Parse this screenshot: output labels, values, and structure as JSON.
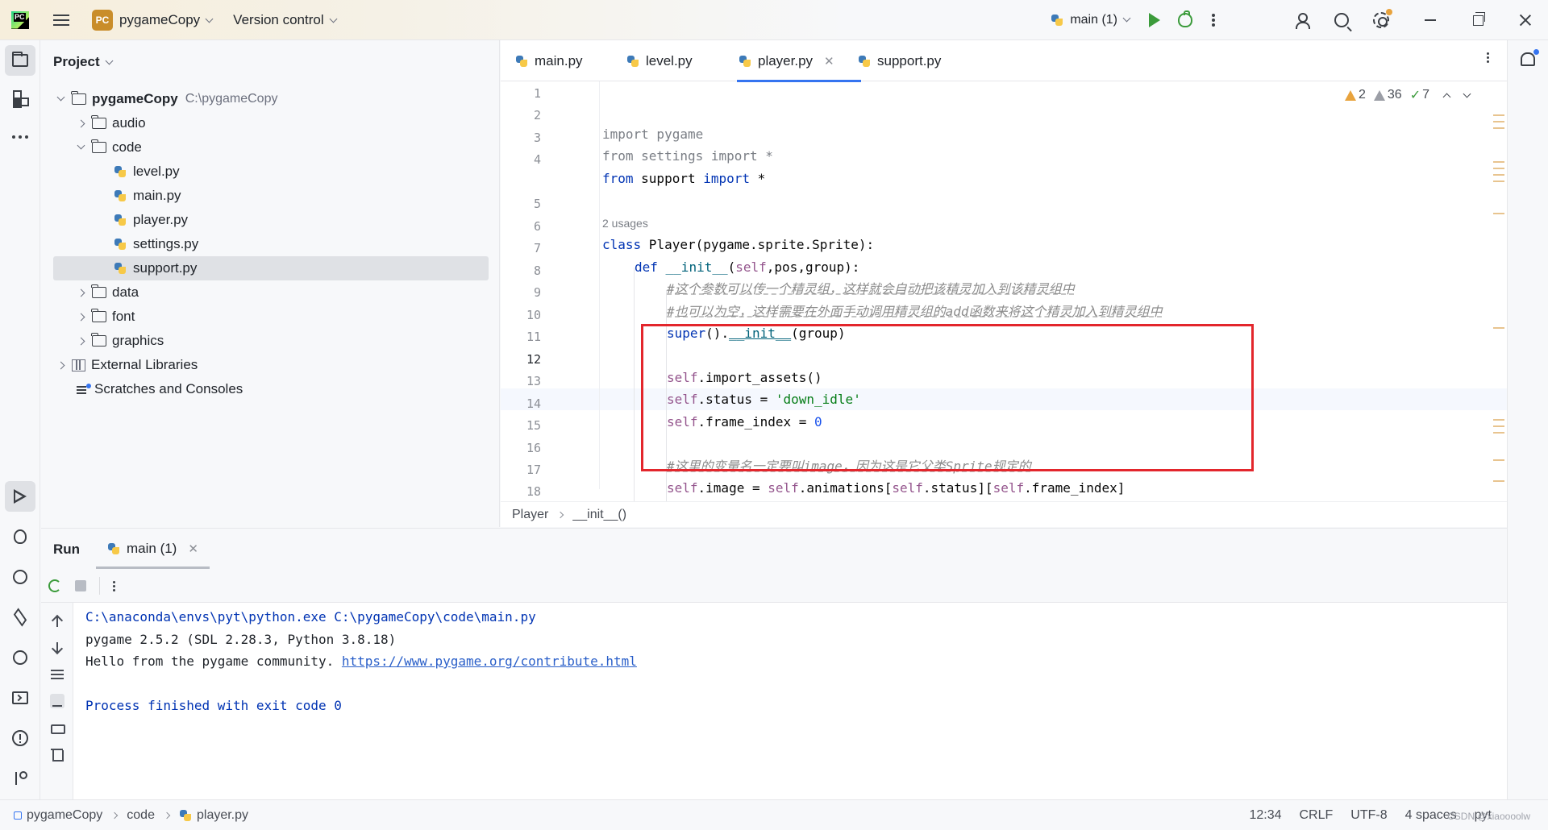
{
  "titlebar": {
    "app_logo_text": "PC",
    "project_badge": "PC",
    "project_name": "pygameCopy",
    "vcs_label": "Version control",
    "run_config": "main (1)"
  },
  "project_panel": {
    "title": "Project",
    "root_name": "pygameCopy",
    "root_path": "C:\\pygameCopy",
    "items": [
      {
        "label": "audio"
      },
      {
        "label": "code"
      },
      {
        "label": "level.py"
      },
      {
        "label": "main.py"
      },
      {
        "label": "player.py"
      },
      {
        "label": "settings.py"
      },
      {
        "label": "support.py"
      },
      {
        "label": "data"
      },
      {
        "label": "font"
      },
      {
        "label": "graphics"
      },
      {
        "label": "External Libraries"
      },
      {
        "label": "Scratches and Consoles"
      }
    ]
  },
  "editor": {
    "tabs": [
      {
        "label": "main.py"
      },
      {
        "label": "level.py"
      },
      {
        "label": "player.py"
      },
      {
        "label": "support.py"
      }
    ],
    "active_tab": "player.py",
    "inspections": {
      "warnings": "2",
      "weak_warnings": "36",
      "typos": "7"
    },
    "usages_hint": "2 usages",
    "line_numbers": [
      "1",
      "2",
      "3",
      "4",
      "5",
      "6",
      "7",
      "8",
      "9",
      "10",
      "11",
      "12",
      "13",
      "14",
      "15",
      "16",
      "17",
      "18"
    ],
    "code": {
      "l1": "import pygame",
      "l2": "from settings import *",
      "l3_from": "from",
      "l3_mod": " support ",
      "l3_import": "import",
      "l3_star": " *",
      "l5_class": "class",
      "l5_rest": " Player(pygame.sprite.Sprite):",
      "l6_def": "def",
      "l6_name": " __init__",
      "l6_open": "(",
      "l6_self": "self",
      "l6_rest": ",pos,group):",
      "l7_comment": "#这个参数可以传一个精灵组，这样就会自动把该精灵加入到该精灵组中",
      "l8_comment": "#也可以为空，这样需要在外面手动调用精灵组的add函数来将这个精灵加入到精灵组中",
      "l9_super": "super",
      "l9_mid": "().",
      "l9_init": "__init__",
      "l9_rest": "(group)",
      "l11_self": "self",
      "l11_rest": ".import_assets()",
      "l12_self": "self",
      "l12_mid": ".status = ",
      "l12_str": "'down_idle'",
      "l13_self": "self",
      "l13_mid": ".frame_index = ",
      "l13_num": "0",
      "l15_comment": "#这里的变量名一定要叫image，因为这是它父类Sprite规定的",
      "l16_self1": "self",
      "l16_a": ".image = ",
      "l16_self2": "self",
      "l16_b": ".animations[",
      "l16_self3": "self",
      "l16_c": ".status][",
      "l16_self4": "self",
      "l16_d": ".frame_index]"
    },
    "breadcrumb": [
      "Player",
      "__init__()"
    ]
  },
  "run_panel": {
    "title": "Run",
    "tab_label": "main (1)",
    "output": {
      "cmd": "C:\\anaconda\\envs\\pyt\\python.exe C:\\pygameCopy\\code\\main.py",
      "line2": "pygame 2.5.2 (SDL 2.28.3, Python 3.8.18)",
      "line3_text": "Hello from the pygame community. ",
      "line3_link": "https://www.pygame.org/contribute.html",
      "line5": "Process finished with exit code 0"
    }
  },
  "statusbar": {
    "path": [
      "pygameCopy",
      "code",
      "player.py"
    ],
    "position": "12:34",
    "line_sep": "CRLF",
    "encoding": "UTF-8",
    "indent": "4 spaces",
    "interpreter": "pyt",
    "watermark": "CSDN @xiaoooolw"
  },
  "colors": {
    "accent": "#3574f0",
    "highlight_box": "#e3262c",
    "run_green": "#3b9b3b",
    "warning": "#e8a33d"
  }
}
